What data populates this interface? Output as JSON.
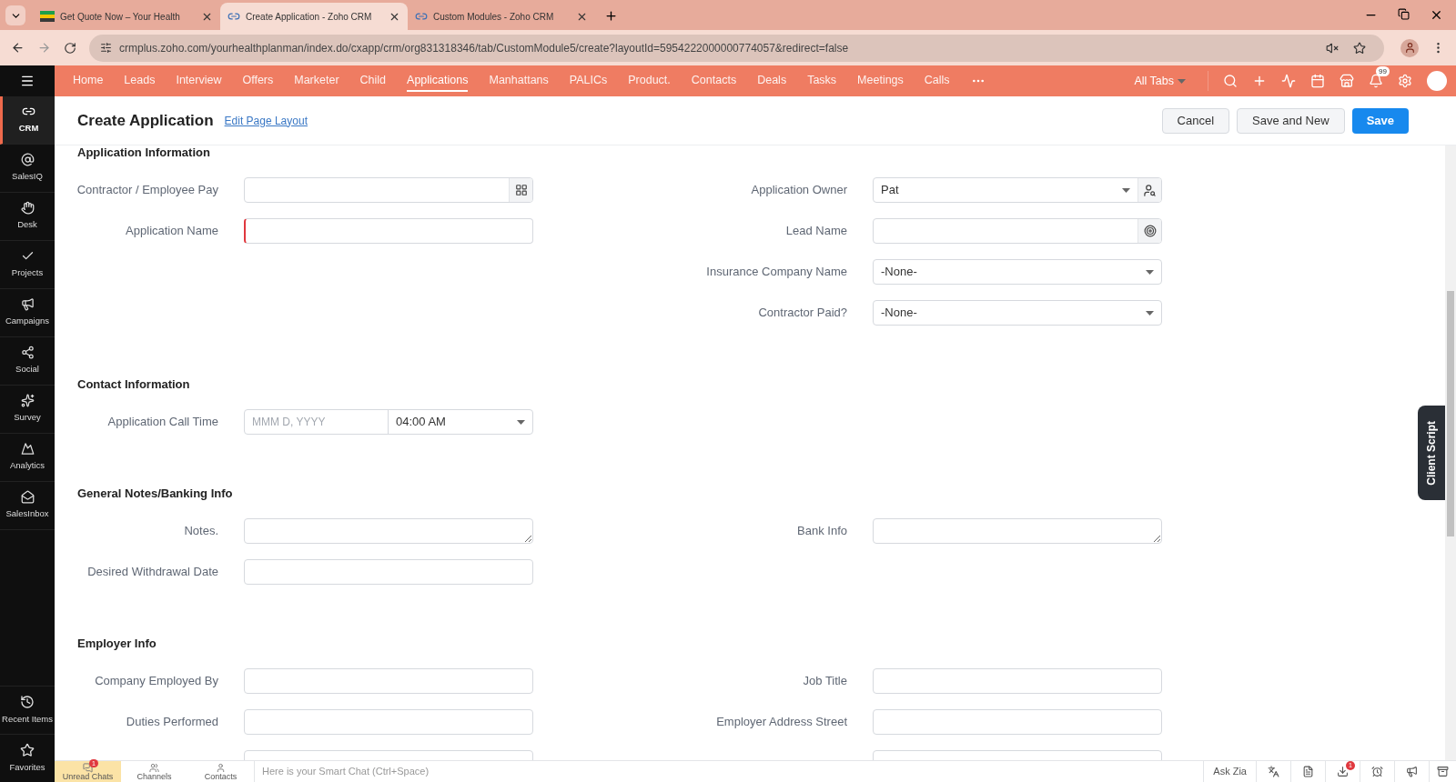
{
  "browser": {
    "tabs": [
      {
        "title": "Get Quote Now – Your Health",
        "selected": false,
        "kind": "flag"
      },
      {
        "title": "Create Application - Zoho CRM",
        "selected": true,
        "kind": "crm"
      },
      {
        "title": "Custom Modules - Zoho CRM",
        "selected": false,
        "kind": "crm"
      }
    ],
    "url": "crmplus.zoho.com/yourhealthplanman/index.do/cxapp/crm/org831318346/tab/CustomModule5/create?layoutId=5954222000000774057&redirect=false"
  },
  "nav": {
    "items": [
      {
        "label": "Home",
        "selected": false
      },
      {
        "label": "Leads",
        "selected": false
      },
      {
        "label": "Interview",
        "selected": false
      },
      {
        "label": "Offers",
        "selected": false
      },
      {
        "label": "Marketer",
        "selected": false
      },
      {
        "label": "Child",
        "selected": false
      },
      {
        "label": "Applications",
        "selected": true
      },
      {
        "label": "Manhattans",
        "selected": false
      },
      {
        "label": "PALICs",
        "selected": false
      },
      {
        "label": "Product.",
        "selected": false
      },
      {
        "label": "Contacts",
        "selected": false
      },
      {
        "label": "Deals",
        "selected": false
      },
      {
        "label": "Tasks",
        "selected": false
      },
      {
        "label": "Meetings",
        "selected": false
      },
      {
        "label": "Calls",
        "selected": false
      }
    ],
    "all_tabs": "All Tabs",
    "notification_badge": "99"
  },
  "sidebar": {
    "items": [
      {
        "label": "CRM",
        "selected": true
      },
      {
        "label": "SalesIQ",
        "selected": false
      },
      {
        "label": "Desk",
        "selected": false
      },
      {
        "label": "Projects",
        "selected": false
      },
      {
        "label": "Campaigns",
        "selected": false
      },
      {
        "label": "Social",
        "selected": false
      },
      {
        "label": "Survey",
        "selected": false
      },
      {
        "label": "Analytics",
        "selected": false
      },
      {
        "label": "SalesInbox",
        "selected": false
      }
    ],
    "bottom_items": [
      {
        "label": "Recent Items"
      },
      {
        "label": "Favorites"
      }
    ]
  },
  "page": {
    "title": "Create Application",
    "link": "Edit Page Layout",
    "buttons": [
      {
        "label": "Cancel",
        "kind": "secondary"
      },
      {
        "label": "Save and New",
        "kind": "secondary"
      },
      {
        "label": "Save",
        "kind": "primary"
      }
    ]
  },
  "sections": [
    {
      "title": "Application Information",
      "rows": [
        {
          "left": {
            "label": "Contractor / Employee Pay",
            "kind": "lookup",
            "required": false
          },
          "right": {
            "label": "Application Owner",
            "kind": "owner",
            "value": "Pat",
            "required": false
          }
        },
        {
          "left": {
            "label": "Application Name",
            "kind": "text",
            "required": true
          },
          "right": {
            "label": "Lead Name",
            "kind": "lead",
            "required": false
          }
        },
        {
          "right": {
            "label": "Insurance Company Name",
            "kind": "select",
            "value": "-None-",
            "required": false
          }
        },
        {
          "right": {
            "label": "Contractor Paid?",
            "kind": "select",
            "value": "-None-",
            "required": false
          }
        }
      ]
    },
    {
      "title": "Contact Information",
      "rows": [
        {
          "left": {
            "label": "Application Call Time",
            "kind": "datetime",
            "placeholder": "MMM D, YYYY",
            "value": "04:00 AM",
            "required": false
          }
        }
      ]
    },
    {
      "title": "General Notes/Banking Info",
      "rows": [
        {
          "left": {
            "label": "Notes.",
            "kind": "textarea",
            "required": false
          },
          "right": {
            "label": "Bank Info",
            "kind": "textarea",
            "required": false
          }
        },
        {
          "left": {
            "label": "Desired Withdrawal Date",
            "kind": "text",
            "required": false
          }
        }
      ]
    },
    {
      "title": "Employer Info",
      "rows": [
        {
          "left": {
            "label": "Company Employed By",
            "kind": "text",
            "required": false
          },
          "right": {
            "label": "Job Title",
            "kind": "text",
            "required": false
          }
        },
        {
          "left": {
            "label": "Duties Performed",
            "kind": "text",
            "required": false
          },
          "right": {
            "label": "Employer Address Street",
            "kind": "text",
            "required": false
          }
        },
        {
          "left": {
            "kind": "text",
            "required": false
          },
          "right": {
            "kind": "text",
            "required": false
          }
        }
      ]
    }
  ],
  "client_script": "Client Script",
  "bottom_bar": {
    "tabs": [
      {
        "label": "Unread Chats",
        "selected": true,
        "badge": "1"
      },
      {
        "label": "Channels",
        "selected": false
      },
      {
        "label": "Contacts",
        "selected": false
      }
    ],
    "chat_placeholder": "Here is your Smart Chat (Ctrl+Space)",
    "ask": "Ask Zia",
    "download_badge": "1"
  }
}
